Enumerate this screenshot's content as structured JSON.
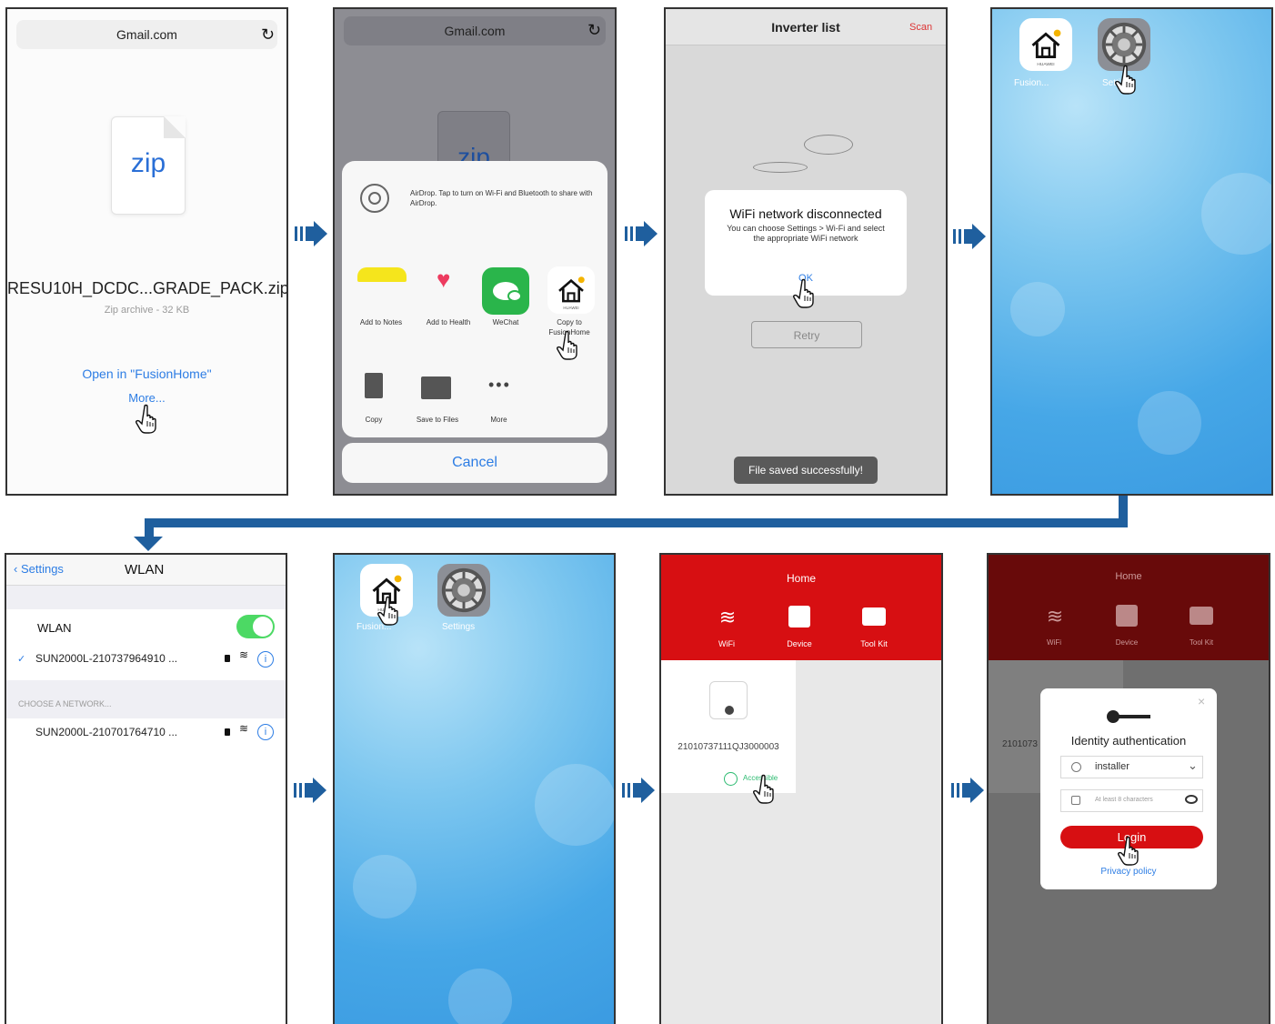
{
  "screens": {
    "s1": {
      "url": "Gmail.com",
      "zip_label": "zip",
      "filename": "RESU10H_DCDC...GRADE_PACK.zip",
      "subtitle": "Zip archive - 32 KB",
      "open_in": "Open in \"FusionHome\"",
      "more": "More..."
    },
    "s2": {
      "url": "Gmail.com",
      "zip_label": "zip",
      "airdrop_text": "AirDrop. Tap to turn on Wi-Fi and Bluetooth to share with AirDrop.",
      "apps": [
        "Add to Notes",
        "Add to Health",
        "WeChat",
        "Copy to FusionHome"
      ],
      "actions": [
        "Copy",
        "Save to Files",
        "More"
      ],
      "cancel": "Cancel"
    },
    "s3": {
      "title": "Inverter list",
      "scan": "Scan",
      "dialog_title": "WiFi network disconnected",
      "dialog_text": "You can choose Settings > Wi-Fi and select the appropriate WiFi network",
      "ok": "OK",
      "retry": "Retry",
      "toast": "File saved successfully!"
    },
    "s4": {
      "app1": "Fusion...",
      "app2": "Settings"
    },
    "s5": {
      "back": "Settings",
      "title": "WLAN",
      "wlan_label": "WLAN",
      "connected": "SUN2000L-210737964910 ...",
      "choose": "CHOOSE A NETWORK...",
      "other": "SUN2000L-210701764710 ..."
    },
    "s6": {
      "app1": "Fusion...",
      "app2": "Settings"
    },
    "s7": {
      "title": "Home",
      "tabs": [
        "WiFi",
        "Device",
        "Tool Kit"
      ],
      "serial": "21010737111QJ3000003",
      "access": "Accessible"
    },
    "s8": {
      "title": "Home",
      "tabs": [
        "WiFi",
        "Device",
        "Tool Kit"
      ],
      "partial_serial": "2101073",
      "heading": "Identity authentication",
      "user_value": "installer",
      "password_placeholder": "At least 8 characters",
      "login": "Login",
      "privacy": "Privacy policy"
    }
  },
  "colors": {
    "accent_blue": "#1f5f9e",
    "ios_blue": "#2d7de4",
    "huawei_red": "#d70f12",
    "wechat_green": "#2ab54b"
  },
  "icons": [
    "zip-file-icon",
    "reload-icon",
    "airdrop-icon",
    "notes-icon",
    "heart-icon",
    "wechat-icon",
    "fusionhome-icon",
    "copy-icon",
    "folder-icon",
    "more-dots-icon",
    "settings-gear-icon",
    "wifi-icon",
    "device-icon",
    "toolkit-icon",
    "key-icon",
    "user-icon",
    "lock-icon",
    "eye-icon",
    "info-icon",
    "check-icon",
    "chevron-down-icon",
    "hand-pointer-icon"
  ]
}
